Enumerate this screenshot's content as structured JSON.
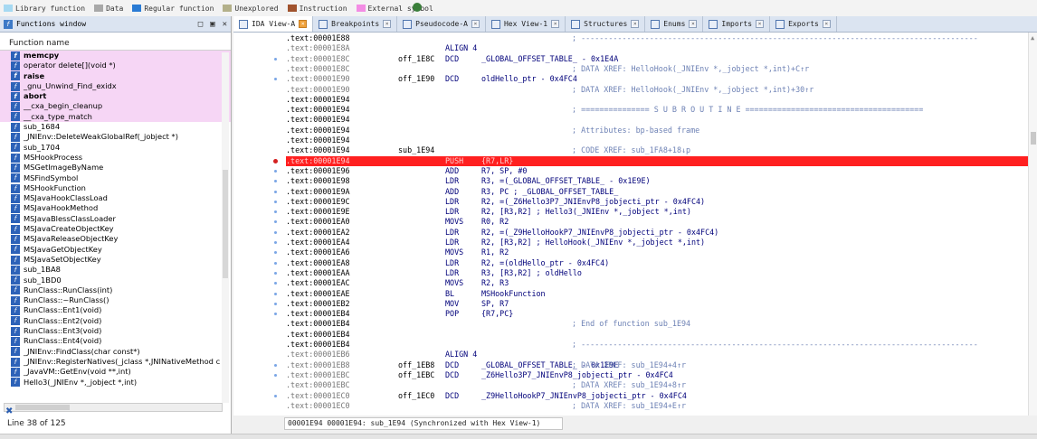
{
  "legend": [
    {
      "label": "Library function",
      "color": "#a6d9f2"
    },
    {
      "label": "Data",
      "color": "#a8a8a8"
    },
    {
      "label": "Regular function",
      "color": "#2a7bd4"
    },
    {
      "label": "Unexplored",
      "color": "#b3b08a"
    },
    {
      "label": "Instruction",
      "color": "#a0522d"
    },
    {
      "label": "External symbol",
      "color": "#f38ce4"
    }
  ],
  "functions_window": {
    "title": "Functions window",
    "column_header": "Function name",
    "status": "Line 38 of 125",
    "items": [
      {
        "name": "memcpy",
        "lib": true,
        "bold": true
      },
      {
        "name": "operator delete[](void *)",
        "lib": true,
        "bold": false
      },
      {
        "name": "raise",
        "lib": true,
        "bold": true
      },
      {
        "name": "_gnu_Unwind_Find_exidx",
        "lib": true,
        "bold": false
      },
      {
        "name": "abort",
        "lib": true,
        "bold": true
      },
      {
        "name": "__cxa_begin_cleanup",
        "lib": true,
        "bold": false
      },
      {
        "name": "__cxa_type_match",
        "lib": true,
        "bold": false
      },
      {
        "name": "sub_1684",
        "lib": false,
        "bold": false
      },
      {
        "name": "_JNIEnv::DeleteWeakGlobalRef(_jobject *)",
        "lib": false,
        "bold": false
      },
      {
        "name": "sub_1704",
        "lib": false,
        "bold": false
      },
      {
        "name": "MSHookProcess",
        "lib": false,
        "bold": false
      },
      {
        "name": "MSGetImageByName",
        "lib": false,
        "bold": false
      },
      {
        "name": "MSFindSymbol",
        "lib": false,
        "bold": false
      },
      {
        "name": "MSHookFunction",
        "lib": false,
        "bold": false
      },
      {
        "name": "MSJavaHookClassLoad",
        "lib": false,
        "bold": false
      },
      {
        "name": "MSJavaHookMethod",
        "lib": false,
        "bold": false
      },
      {
        "name": "MSJavaBlessClassLoader",
        "lib": false,
        "bold": false
      },
      {
        "name": "MSJavaCreateObjectKey",
        "lib": false,
        "bold": false
      },
      {
        "name": "MSJavaReleaseObjectKey",
        "lib": false,
        "bold": false
      },
      {
        "name": "MSJavaGetObjectKey",
        "lib": false,
        "bold": false
      },
      {
        "name": "MSJavaSetObjectKey",
        "lib": false,
        "bold": false
      },
      {
        "name": "sub_1BA8",
        "lib": false,
        "bold": false
      },
      {
        "name": "sub_1BD0",
        "lib": false,
        "bold": false
      },
      {
        "name": "RunClass::RunClass(int)",
        "lib": false,
        "bold": false
      },
      {
        "name": "RunClass::~RunClass()",
        "lib": false,
        "bold": false
      },
      {
        "name": "RunClass::Ent1(void)",
        "lib": false,
        "bold": false
      },
      {
        "name": "RunClass::Ent2(void)",
        "lib": false,
        "bold": false
      },
      {
        "name": "RunClass::Ent3(void)",
        "lib": false,
        "bold": false
      },
      {
        "name": "RunClass::Ent4(void)",
        "lib": false,
        "bold": false
      },
      {
        "name": "_JNIEnv::FindClass(char const*)",
        "lib": false,
        "bold": false
      },
      {
        "name": "_JNIEnv::RegisterNatives(_jclass *,JNINativeMethod c",
        "lib": false,
        "bold": false
      },
      {
        "name": "_JavaVM::GetEnv(void **,int)",
        "lib": false,
        "bold": false
      },
      {
        "name": "Hello3(_JNIEnv *,_jobject *,int)",
        "lib": false,
        "bold": false
      }
    ]
  },
  "tabs": [
    {
      "label": "IDA View-A",
      "active": true
    },
    {
      "label": "Breakpoints",
      "active": false
    },
    {
      "label": "Pseudocode-A",
      "active": false
    },
    {
      "label": "Hex View-1",
      "active": false
    },
    {
      "label": "Structures",
      "active": false
    },
    {
      "label": "Enums",
      "active": false
    },
    {
      "label": "Imports",
      "active": false
    },
    {
      "label": "Exports",
      "active": false
    }
  ],
  "disasm": {
    "status": "00001E94 00001E94: sub_1E94 (Synchronized with Hex View-1)",
    "lines": [
      {
        "addr": ".text:00001E88",
        "label": "",
        "mn": "",
        "op": "",
        "cm": "; ---------------------------------------------------------------------------------------",
        "gray": false,
        "dot": false,
        "bp": false,
        "hl": false
      },
      {
        "addr": ".text:00001E8A",
        "label": "",
        "mn": "ALIGN 4",
        "op": "",
        "cm": "",
        "gray": true,
        "dot": false,
        "bp": false,
        "hl": false
      },
      {
        "addr": ".text:00001E8C",
        "label": "off_1E8C",
        "mn": "DCD",
        "op": "_GLOBAL_OFFSET_TABLE_ - 0x1E4A",
        "cm": "",
        "gray": true,
        "dot": true,
        "bp": false,
        "hl": false
      },
      {
        "addr": ".text:00001E8C",
        "label": "",
        "mn": "",
        "op": "",
        "cm": "; DATA XREF: HelloHook(_JNIEnv *,_jobject *,int)+C↑r",
        "gray": true,
        "dot": false,
        "bp": false,
        "hl": false
      },
      {
        "addr": ".text:00001E90",
        "label": "off_1E90",
        "mn": "DCD",
        "op": "oldHello_ptr - 0x4FC4",
        "cm": "",
        "gray": true,
        "dot": true,
        "bp": false,
        "hl": false
      },
      {
        "addr": ".text:00001E90",
        "label": "",
        "mn": "",
        "op": "",
        "cm": "; DATA XREF: HelloHook(_JNIEnv *,_jobject *,int)+30↑r",
        "gray": true,
        "dot": false,
        "bp": false,
        "hl": false
      },
      {
        "addr": ".text:00001E94",
        "label": "",
        "mn": "",
        "op": "",
        "cm": "",
        "gray": false,
        "dot": false,
        "bp": false,
        "hl": false
      },
      {
        "addr": ".text:00001E94",
        "label": "",
        "mn": "",
        "op": "",
        "cm": "; =============== S U B R O U T I N E =======================================",
        "gray": false,
        "dot": false,
        "bp": false,
        "hl": false
      },
      {
        "addr": ".text:00001E94",
        "label": "",
        "mn": "",
        "op": "",
        "cm": "",
        "gray": false,
        "dot": false,
        "bp": false,
        "hl": false
      },
      {
        "addr": ".text:00001E94",
        "label": "",
        "mn": "",
        "op": "",
        "cm": "; Attributes: bp-based frame",
        "gray": false,
        "dot": false,
        "bp": false,
        "hl": false
      },
      {
        "addr": ".text:00001E94",
        "label": "",
        "mn": "",
        "op": "",
        "cm": "",
        "gray": false,
        "dot": false,
        "bp": false,
        "hl": false
      },
      {
        "addr": ".text:00001E94",
        "label": "sub_1E94",
        "mn": "",
        "op": "",
        "cm": "; CODE XREF: sub_1FA8+18↓p",
        "gray": false,
        "dot": false,
        "bp": false,
        "hl": false
      },
      {
        "addr": ".text:00001E94",
        "label": "",
        "mn": "PUSH",
        "op": "{R7,LR}",
        "cm": "",
        "gray": false,
        "dot": false,
        "bp": true,
        "hl": true
      },
      {
        "addr": ".text:00001E96",
        "label": "",
        "mn": "ADD",
        "op": "R7, SP, #0",
        "cm": "",
        "gray": false,
        "dot": true,
        "bp": false,
        "hl": false
      },
      {
        "addr": ".text:00001E98",
        "label": "",
        "mn": "LDR",
        "op": "R3, =(_GLOBAL_OFFSET_TABLE_ - 0x1E9E)",
        "cm": "",
        "gray": false,
        "dot": true,
        "bp": false,
        "hl": false
      },
      {
        "addr": ".text:00001E9A",
        "label": "",
        "mn": "ADD",
        "op": "R3, PC ; _GLOBAL_OFFSET_TABLE_",
        "cm": "",
        "gray": false,
        "dot": true,
        "bp": false,
        "hl": false
      },
      {
        "addr": ".text:00001E9C",
        "label": "",
        "mn": "LDR",
        "op": "R2, =(_Z6Hello3P7_JNIEnvP8_jobjecti_ptr - 0x4FC4)",
        "cm": "",
        "gray": false,
        "dot": true,
        "bp": false,
        "hl": false
      },
      {
        "addr": ".text:00001E9E",
        "label": "",
        "mn": "LDR",
        "op": "R2, [R3,R2] ; Hello3(_JNIEnv *,_jobject *,int)",
        "cm": "",
        "gray": false,
        "dot": true,
        "bp": false,
        "hl": false
      },
      {
        "addr": ".text:00001EA0",
        "label": "",
        "mn": "MOVS",
        "op": "R0, R2",
        "cm": "",
        "gray": false,
        "dot": true,
        "bp": false,
        "hl": false
      },
      {
        "addr": ".text:00001EA2",
        "label": "",
        "mn": "LDR",
        "op": "R2, =(_Z9HelloHookP7_JNIEnvP8_jobjecti_ptr - 0x4FC4)",
        "cm": "",
        "gray": false,
        "dot": true,
        "bp": false,
        "hl": false
      },
      {
        "addr": ".text:00001EA4",
        "label": "",
        "mn": "LDR",
        "op": "R2, [R3,R2] ; HelloHook(_JNIEnv *,_jobject *,int)",
        "cm": "",
        "gray": false,
        "dot": true,
        "bp": false,
        "hl": false
      },
      {
        "addr": ".text:00001EA6",
        "label": "",
        "mn": "MOVS",
        "op": "R1, R2",
        "cm": "",
        "gray": false,
        "dot": true,
        "bp": false,
        "hl": false
      },
      {
        "addr": ".text:00001EA8",
        "label": "",
        "mn": "LDR",
        "op": "R2, =(oldHello_ptr - 0x4FC4)",
        "cm": "",
        "gray": false,
        "dot": true,
        "bp": false,
        "hl": false
      },
      {
        "addr": ".text:00001EAA",
        "label": "",
        "mn": "LDR",
        "op": "R3, [R3,R2] ; oldHello",
        "cm": "",
        "gray": false,
        "dot": true,
        "bp": false,
        "hl": false
      },
      {
        "addr": ".text:00001EAC",
        "label": "",
        "mn": "MOVS",
        "op": "R2, R3",
        "cm": "",
        "gray": false,
        "dot": true,
        "bp": false,
        "hl": false
      },
      {
        "addr": ".text:00001EAE",
        "label": "",
        "mn": "BL",
        "op": "MSHookFunction",
        "cm": "",
        "gray": false,
        "dot": true,
        "bp": false,
        "hl": false
      },
      {
        "addr": ".text:00001EB2",
        "label": "",
        "mn": "MOV",
        "op": "SP, R7",
        "cm": "",
        "gray": false,
        "dot": true,
        "bp": false,
        "hl": false
      },
      {
        "addr": ".text:00001EB4",
        "label": "",
        "mn": "POP",
        "op": "{R7,PC}",
        "cm": "",
        "gray": false,
        "dot": true,
        "bp": false,
        "hl": false
      },
      {
        "addr": ".text:00001EB4",
        "label": "",
        "mn": "",
        "op": "",
        "cm": "; End of function sub_1E94",
        "gray": false,
        "dot": false,
        "bp": false,
        "hl": false
      },
      {
        "addr": ".text:00001EB4",
        "label": "",
        "mn": "",
        "op": "",
        "cm": "",
        "gray": false,
        "dot": false,
        "bp": false,
        "hl": false
      },
      {
        "addr": ".text:00001EB4",
        "label": "",
        "mn": "",
        "op": "",
        "cm": "; ---------------------------------------------------------------------------------------",
        "gray": false,
        "dot": false,
        "bp": false,
        "hl": false
      },
      {
        "addr": ".text:00001EB6",
        "label": "",
        "mn": "ALIGN 4",
        "op": "",
        "cm": "",
        "gray": true,
        "dot": false,
        "bp": false,
        "hl": false
      },
      {
        "addr": ".text:00001EB8",
        "label": "off_1EB8",
        "mn": "DCD",
        "op": "_GLOBAL_OFFSET_TABLE_ - 0x1E9E",
        "cm": "; DATA XREF: sub_1E94+4↑r",
        "gray": true,
        "dot": true,
        "bp": false,
        "hl": false
      },
      {
        "addr": ".text:00001EBC",
        "label": "off_1EBC",
        "mn": "DCD",
        "op": "_Z6Hello3P7_JNIEnvP8_jobjecti_ptr - 0x4FC4",
        "cm": "",
        "gray": true,
        "dot": true,
        "bp": false,
        "hl": false
      },
      {
        "addr": ".text:00001EBC",
        "label": "",
        "mn": "",
        "op": "",
        "cm": "; DATA XREF: sub_1E94+8↑r",
        "gray": true,
        "dot": false,
        "bp": false,
        "hl": false
      },
      {
        "addr": ".text:00001EC0",
        "label": "off_1EC0",
        "mn": "DCD",
        "op": "_Z9HelloHookP7_JNIEnvP8_jobjecti_ptr - 0x4FC4",
        "cm": "",
        "gray": true,
        "dot": true,
        "bp": false,
        "hl": false
      },
      {
        "addr": ".text:00001EC0",
        "label": "",
        "mn": "",
        "op": "",
        "cm": "; DATA XREF: sub_1E94+E↑r",
        "gray": true,
        "dot": false,
        "bp": false,
        "hl": false
      }
    ]
  }
}
